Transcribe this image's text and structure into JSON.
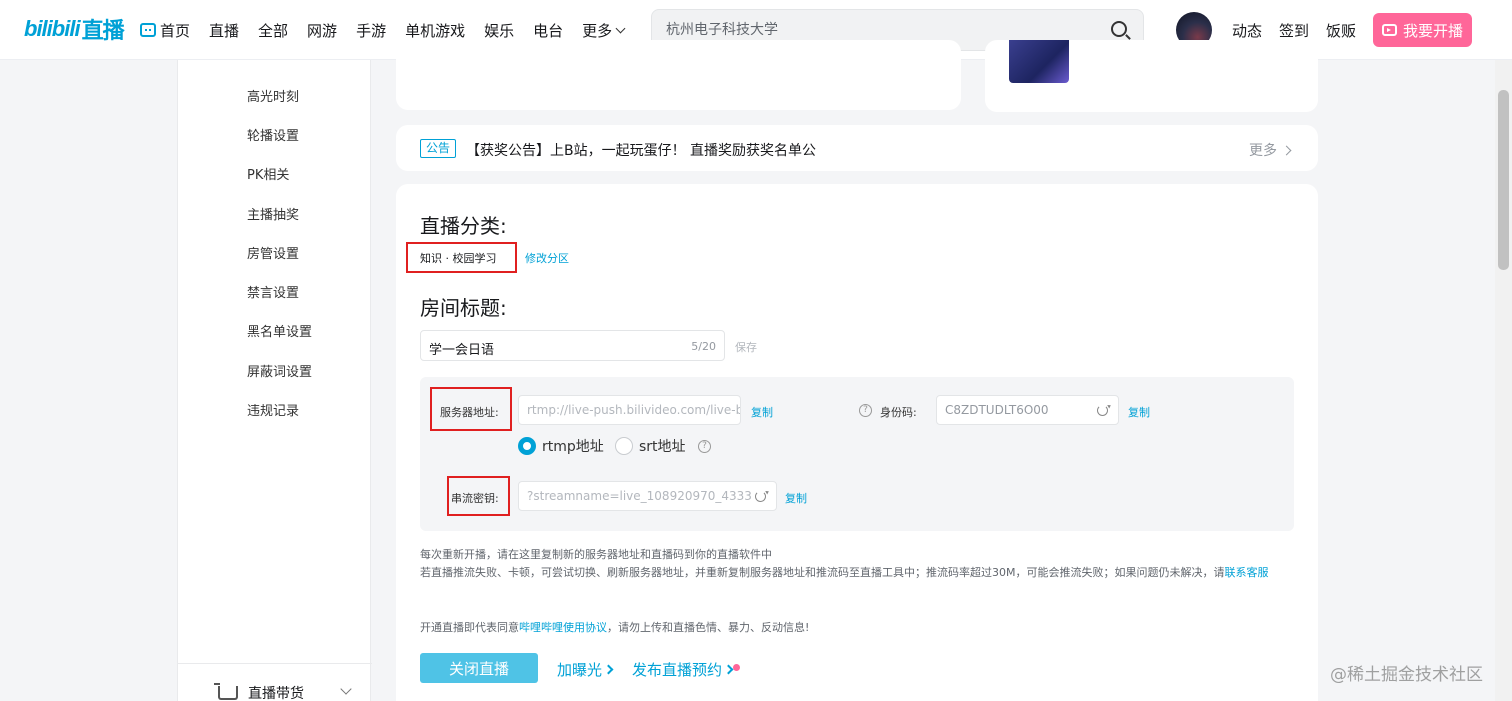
{
  "logo": {
    "brand": "bilibili",
    "suffix": "直播"
  },
  "nav": {
    "items": [
      "首页",
      "直播",
      "全部",
      "网游",
      "手游",
      "单机游戏",
      "娱乐",
      "电台",
      "更多"
    ]
  },
  "search": {
    "value": "杭州电子科技大学"
  },
  "header_links": {
    "dynamic": "动态",
    "checkin": "签到",
    "shop": "饭贩",
    "go_live": "我要开播"
  },
  "sidebar": {
    "items": [
      "高光时刻",
      "轮播设置",
      "PK相关",
      "主播抽奖",
      "房管设置",
      "禁言设置",
      "黑名单设置",
      "屏蔽词设置",
      "违规记录"
    ],
    "bottom": "直播带货"
  },
  "notice": {
    "badge": "公告",
    "text": "【获奖公告】上B站，一起玩蛋仔！ 直播奖励获奖名单公",
    "more": "更多"
  },
  "category": {
    "heading": "直播分类:",
    "value": "知识 · 校园学习",
    "edit": "修改分区"
  },
  "room_title": {
    "heading": "房间标题:",
    "value": "学一会日语",
    "count": "5/20",
    "save": "保存"
  },
  "stream": {
    "server_label": "服务器地址:",
    "server_value": "rtmp://live-push.bilivideo.com/live-bvc/",
    "copy": "复制",
    "id_label": "身份码:",
    "id_value": "C8ZDTUDLT6O00",
    "protocol_rtmp": "rtmp地址",
    "protocol_srt": "srt地址",
    "key_label": "串流密钥:",
    "key_value": "?streamname=live_108920970_4333"
  },
  "tips": {
    "line1": "每次重新开播，请在这里复制新的服务器地址和直播码到你的直播软件中",
    "line2": "若直播推流失败、卡顿，可尝试切换、刷新服务器地址，并重新复制服务器地址和推流码至直播工具中；推流码率超过30M，可能会推流失败；如果问题仍未解决，请",
    "line2_link": "联系客服",
    "agree_pre": "开通直播即代表同意",
    "agree_link": "哔哩哔哩使用协议",
    "agree_post": "，请勿上传和直播色情、暴力、反动信息!"
  },
  "actions": {
    "close": "关闭直播",
    "boost": "加曝光",
    "schedule": "发布直播预约"
  },
  "watermark": "@稀土掘金技术社区",
  "colors": {
    "accent": "#00a1d6",
    "pink": "#ff6699",
    "highlight": "#e02020"
  }
}
